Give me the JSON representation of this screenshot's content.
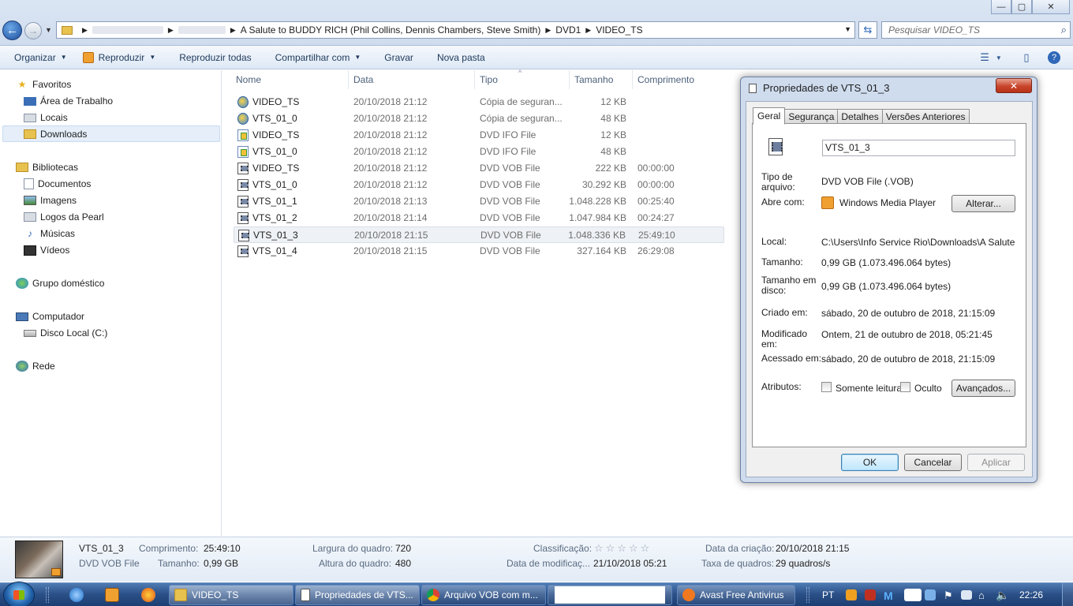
{
  "window": {
    "minimize": "—",
    "maximize": "▢",
    "close": "✕"
  },
  "address": {
    "crumbs": [
      "A Salute to BUDDY RICH (Phil Collins, Dennis Chambers, Steve Smith)",
      "DVD1",
      "VIDEO_TS"
    ],
    "search_placeholder": "Pesquisar VIDEO_TS"
  },
  "toolbar": {
    "organize": "Organizar",
    "play": "Reproduzir",
    "play_all": "Reproduzir todas",
    "share": "Compartilhar com",
    "burn": "Gravar",
    "new_folder": "Nova pasta"
  },
  "nav": {
    "favorites": "Favoritos",
    "desktop": "Área de Trabalho",
    "places": "Locais",
    "downloads": "Downloads",
    "libraries": "Bibliotecas",
    "documents": "Documentos",
    "images": "Imagens",
    "pearl_logos": "Logos da Pearl",
    "music": "Músicas",
    "videos": "Vídeos",
    "homegroup": "Grupo doméstico",
    "computer": "Computador",
    "local_disk": "Disco Local (C:)",
    "network": "Rede"
  },
  "columns": {
    "name": "Nome",
    "date": "Data",
    "type": "Tipo",
    "size": "Tamanho",
    "length": "Comprimento"
  },
  "files": [
    {
      "name": "VIDEO_TS",
      "date": "20/10/2018 21:12",
      "type": "Cópia de seguran...",
      "size": "12 KB",
      "length": "",
      "icon": "backup-icon"
    },
    {
      "name": "VTS_01_0",
      "date": "20/10/2018 21:12",
      "type": "Cópia de seguran...",
      "size": "48 KB",
      "length": "",
      "icon": "backup-icon"
    },
    {
      "name": "VIDEO_TS",
      "date": "20/10/2018 21:12",
      "type": "DVD IFO File",
      "size": "12 KB",
      "length": "",
      "icon": "ifo-icon"
    },
    {
      "name": "VTS_01_0",
      "date": "20/10/2018 21:12",
      "type": "DVD IFO File",
      "size": "48 KB",
      "length": "",
      "icon": "ifo-icon"
    },
    {
      "name": "VIDEO_TS",
      "date": "20/10/2018 21:12",
      "type": "DVD VOB File",
      "size": "222 KB",
      "length": "00:00:00",
      "icon": "vob-icon"
    },
    {
      "name": "VTS_01_0",
      "date": "20/10/2018 21:12",
      "type": "DVD VOB File",
      "size": "30.292 KB",
      "length": "00:00:00",
      "icon": "vob-icon"
    },
    {
      "name": "VTS_01_1",
      "date": "20/10/2018 21:13",
      "type": "DVD VOB File",
      "size": "1.048.228 KB",
      "length": "00:25:40",
      "icon": "vob-icon"
    },
    {
      "name": "VTS_01_2",
      "date": "20/10/2018 21:14",
      "type": "DVD VOB File",
      "size": "1.047.984 KB",
      "length": "00:24:27",
      "icon": "vob-icon"
    },
    {
      "name": "VTS_01_3",
      "date": "20/10/2018 21:15",
      "type": "DVD VOB File",
      "size": "1.048.336 KB",
      "length": "25:49:10",
      "icon": "vob-icon"
    },
    {
      "name": "VTS_01_4",
      "date": "20/10/2018 21:15",
      "type": "DVD VOB File",
      "size": "327.164 KB",
      "length": "26:29:08",
      "icon": "vob-icon"
    }
  ],
  "dialog": {
    "title": "Propriedades de VTS_01_3",
    "close": "✕",
    "tabs": [
      "Geral",
      "Segurança",
      "Detalhes",
      "Versões Anteriores"
    ],
    "filename": "VTS_01_3",
    "type_label": "Tipo de arquivo:",
    "type_value": "DVD VOB File (.VOB)",
    "opens_label": "Abre com:",
    "opens_value": "Windows Media Player",
    "change_btn": "Alterar...",
    "location_label": "Local:",
    "location_value": "C:\\Users\\Info Service Rio\\Downloads\\A Salute to B",
    "size_label": "Tamanho:",
    "size_value": "0,99 GB (1.073.496.064 bytes)",
    "disk_label": "Tamanho em disco:",
    "disk_value": "0,99 GB (1.073.496.064 bytes)",
    "created_label": "Criado em:",
    "created_value": "sábado, 20 de outubro de 2018, 21:15:09",
    "modified_label": "Modificado em:",
    "modified_value": "Ontem, 21 de outubro de 2018, 05:21:45",
    "accessed_label": "Acessado em:",
    "accessed_value": "sábado, 20 de outubro de 2018, 21:15:09",
    "attrs_label": "Atributos:",
    "readonly": "Somente leitura",
    "hidden": "Oculto",
    "advanced_btn": "Avançados...",
    "ok": "OK",
    "cancel": "Cancelar",
    "apply": "Aplicar"
  },
  "details": {
    "name": "VTS_01_3",
    "type": "DVD VOB File",
    "length_label": "Comprimento:",
    "length_value": "25:49:10",
    "size_label": "Tamanho:",
    "size_value": "0,99 GB",
    "width_label": "Largura do quadro:",
    "width_value": "720",
    "height_label": "Altura do quadro:",
    "height_value": "480",
    "rating_label": "Classificação:",
    "rating_stars": "☆☆☆☆☆",
    "modified_label": "Data de modificaç...",
    "modified_value": "21/10/2018 05:21",
    "created_label": "Data da criação:",
    "created_value": "20/10/2018 21:15",
    "framerate_label": "Taxa de quadros:",
    "framerate_value": "29 quadros/s"
  },
  "taskbar": {
    "items": [
      "VIDEO_TS",
      "Propriedades de VTS...",
      "Arquivo VOB com m...",
      "Avast Free Antivirus"
    ],
    "lang": "PT",
    "clock": "22:26"
  }
}
